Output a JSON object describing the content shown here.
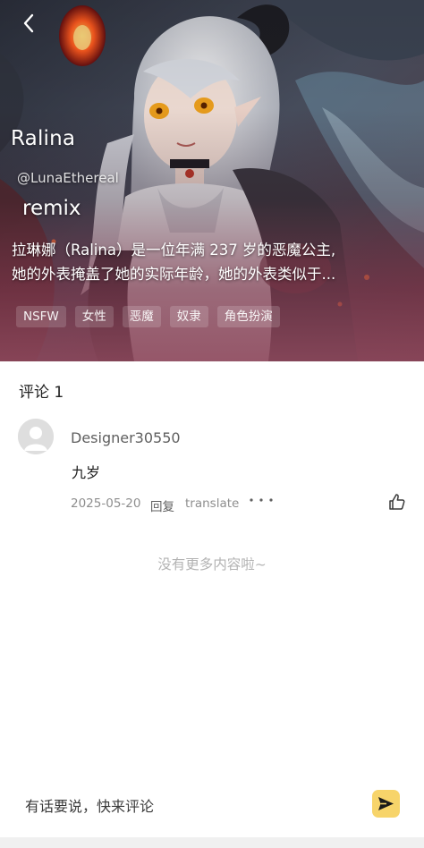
{
  "header": {
    "back_icon": "chevron-left-icon"
  },
  "character": {
    "name": "Ralina",
    "author": "@LunaEthereal",
    "remix_label": "remix",
    "description_lines": [
      "拉琳娜（Ralina）是一位年满 237 岁的恶魔公主,",
      "她的外表掩盖了她的实际年龄，她的外表类似于..."
    ],
    "tags": [
      "NSFW",
      "女性",
      "恶魔",
      "奴隶",
      "角色扮演"
    ]
  },
  "comments": {
    "header": "评论 1",
    "items": [
      {
        "username": "Designer30550",
        "text": "九岁",
        "date": "2025-05-20",
        "reply_label": "回复",
        "translate_label": "translate",
        "more_icon": "more-dots-icon",
        "like_icon": "thumbs-up-icon"
      }
    ],
    "end_text": "没有更多内容啦~"
  },
  "comment_bar": {
    "placeholder": "有话要说，快来评论",
    "send_icon": "send-icon"
  },
  "colors": {
    "send_button": "#f7d46a",
    "meta_text": "#8e8e8e",
    "end_text": "#b3b3b3"
  }
}
